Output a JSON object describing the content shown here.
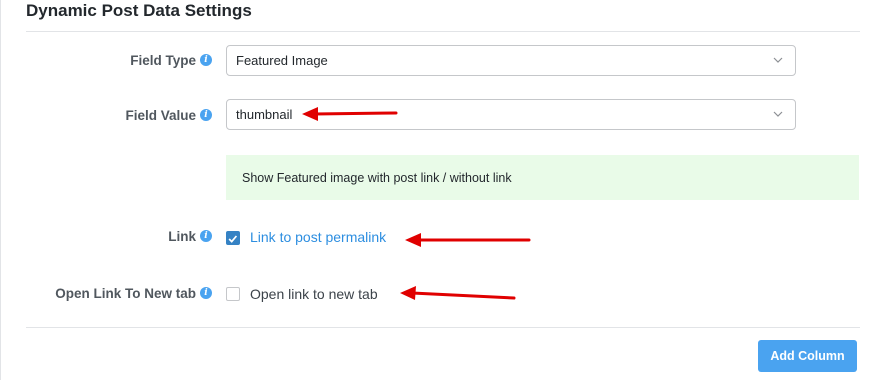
{
  "panel": {
    "title": "Dynamic Post Data Settings"
  },
  "fields": {
    "field_type": {
      "label": "Field Type",
      "value": "Featured Image"
    },
    "field_value": {
      "label": "Field Value",
      "value": "thumbnail"
    },
    "notice": "Show Featured image with post link / without link",
    "link": {
      "label": "Link",
      "checkbox_label": "Link to post permalink",
      "checked": true
    },
    "new_tab": {
      "label": "Open Link To New tab",
      "checkbox_label": "Open link to new tab",
      "checked": false
    }
  },
  "actions": {
    "add_column": "Add Column"
  },
  "icons": {
    "info": "info-icon",
    "chevron": "chevron-down-icon",
    "check": "check-icon",
    "arrow": "red-arrow-annotation"
  },
  "colors": {
    "accent": "#4aa3f0",
    "checkbox": "#3582c4",
    "link": "#2d8ee0",
    "notice_bg": "#e9fbe8",
    "annotation": "#e00000"
  }
}
